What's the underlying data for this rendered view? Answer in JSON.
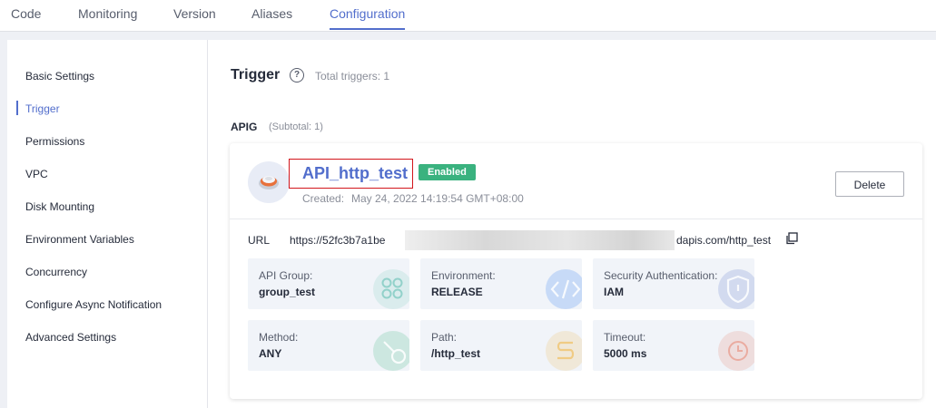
{
  "tabs": [
    {
      "label": "Code"
    },
    {
      "label": "Monitoring"
    },
    {
      "label": "Version"
    },
    {
      "label": "Aliases"
    },
    {
      "label": "Configuration"
    }
  ],
  "active_tab": "Configuration",
  "sidebar": {
    "items": [
      {
        "label": "Basic Settings"
      },
      {
        "label": "Trigger"
      },
      {
        "label": "Permissions"
      },
      {
        "label": "VPC"
      },
      {
        "label": "Disk Mounting"
      },
      {
        "label": "Environment Variables"
      },
      {
        "label": "Concurrency"
      },
      {
        "label": "Configure Async Notification"
      },
      {
        "label": "Advanced Settings"
      }
    ],
    "active": "Trigger"
  },
  "main": {
    "title": "Trigger",
    "help_icon": "question-circle-icon",
    "total_text": "Total triggers: 1",
    "group_label": "APIG",
    "group_subtotal": "(Subtotal: 1)"
  },
  "trigger": {
    "name": "API_http_test",
    "status": "Enabled",
    "created_label": "Created:",
    "created_value": "May 24, 2022 14:19:54 GMT+08:00",
    "delete_label": "Delete",
    "url_label": "URL",
    "url_start": "https://52fc3b7a1be",
    "url_end": "dapis.com/http_test",
    "details": [
      {
        "label": "API Group:",
        "value": "group_test",
        "icon": "grid-icon",
        "color": "#3ab2a0"
      },
      {
        "label": "Environment:",
        "value": "RELEASE",
        "icon": "code-icon",
        "color": "#4c8cf5"
      },
      {
        "label": "Security Authentication:",
        "value": "IAM",
        "icon": "shield-icon",
        "color": "#8a9fd6"
      },
      {
        "label": "Method:",
        "value": "ANY",
        "icon": "method-icon",
        "color": "#3ab27f"
      },
      {
        "label": "Path:",
        "value": "/http_test",
        "icon": "path-icon",
        "color": "#f0b240"
      },
      {
        "label": "Timeout:",
        "value": "5000 ms",
        "icon": "clock-icon",
        "color": "#e8846f"
      }
    ]
  },
  "colors": {
    "accent": "#526ecc",
    "enabled": "#3ab27f",
    "highlight_border": "#d2151b"
  }
}
